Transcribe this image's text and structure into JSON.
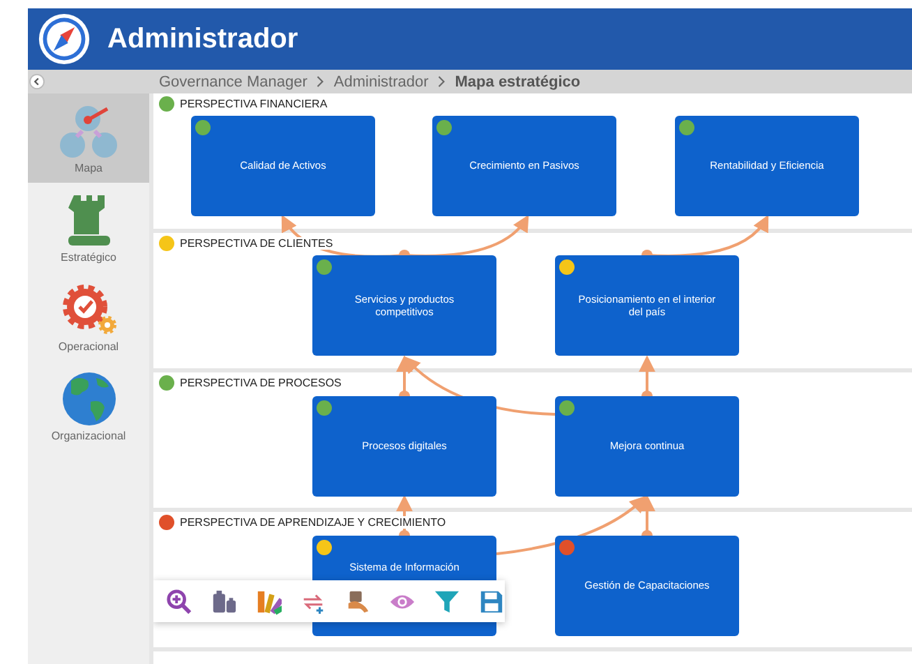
{
  "header": {
    "title": "Administrador"
  },
  "breadcrumb": [
    {
      "label": "Governance Manager",
      "current": false
    },
    {
      "label": "Administrador",
      "current": false
    },
    {
      "label": "Mapa estratégico",
      "current": true
    }
  ],
  "sidebar": {
    "items": [
      {
        "label": "Mapa",
        "kind": "map",
        "selected": true
      },
      {
        "label": "Estratégico",
        "kind": "rook",
        "selected": false
      },
      {
        "label": "Operacional",
        "kind": "gear",
        "selected": false
      },
      {
        "label": "Organizacional",
        "kind": "globe",
        "selected": false
      }
    ]
  },
  "perspectives": [
    {
      "label": "PERSPECTIVA FINANCIERA",
      "color": "#6ab04c",
      "objectives": [
        {
          "title": "Calidad de Activos",
          "color": "#6ab04c"
        },
        {
          "title": "Crecimiento en Pasivos",
          "color": "#6ab04c"
        },
        {
          "title": "Rentabilidad y Eficiencia",
          "color": "#6ab04c"
        }
      ]
    },
    {
      "label": "PERSPECTIVA DE CLIENTES",
      "color": "#f5c518",
      "objectives": [
        {
          "title": "Servicios y productos competitivos",
          "color": "#6ab04c"
        },
        {
          "title": "Posicionamiento en el interior del país",
          "color": "#f5c518"
        }
      ]
    },
    {
      "label": "PERSPECTIVA DE PROCESOS",
      "color": "#6ab04c",
      "objectives": [
        {
          "title": "Procesos digitales",
          "color": "#6ab04c"
        },
        {
          "title": "Mejora continua",
          "color": "#6ab04c"
        }
      ]
    },
    {
      "label": "PERSPECTIVA DE APRENDIZAJE Y CRECIMIENTO",
      "color": "#e0502a",
      "objectives": [
        {
          "title": "Sistema de Información",
          "color": "#f5c518"
        },
        {
          "title": "Gestión de Capacitaciones",
          "color": "#e0502a"
        }
      ]
    }
  ],
  "toolbar": [
    {
      "kind": "zoom"
    },
    {
      "kind": "weights"
    },
    {
      "kind": "palette"
    },
    {
      "kind": "swap"
    },
    {
      "kind": "hand"
    },
    {
      "kind": "eye"
    },
    {
      "kind": "filter"
    },
    {
      "kind": "save"
    }
  ]
}
